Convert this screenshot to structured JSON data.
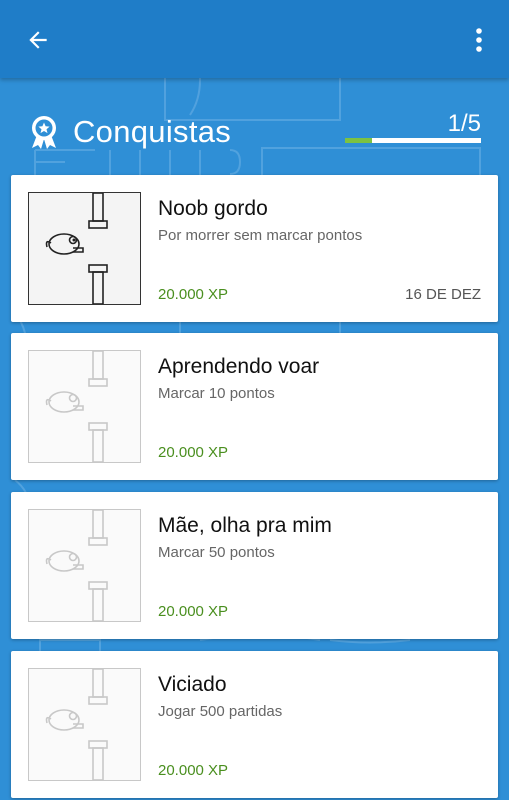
{
  "screen": {
    "title": "Conquistas",
    "progress_text": "1/5",
    "progress_fraction": 0.2
  },
  "toolbar": {
    "back_icon": "arrow-left-icon",
    "menu_icon": "more-vert-icon"
  },
  "colors": {
    "background": "#2f8fd6",
    "toolbar": "#1f7dc8",
    "progress_fill": "#7cc243",
    "xp_text": "#4a8f1f"
  },
  "achievements": [
    {
      "title": "Noob gordo",
      "description": "Por morrer sem marcar pontos",
      "xp": "20.000 XP",
      "date": "16 DE DEZ",
      "unlocked": true
    },
    {
      "title": "Aprendendo voar",
      "description": "Marcar 10 pontos",
      "xp": "20.000 XP",
      "date": "",
      "unlocked": false
    },
    {
      "title": "Mãe, olha pra mim",
      "description": "Marcar 50 pontos",
      "xp": "20.000 XP",
      "date": "",
      "unlocked": false
    },
    {
      "title": "Viciado",
      "description": "Jogar 500 partidas",
      "xp": "20.000 XP",
      "date": "",
      "unlocked": false
    }
  ]
}
